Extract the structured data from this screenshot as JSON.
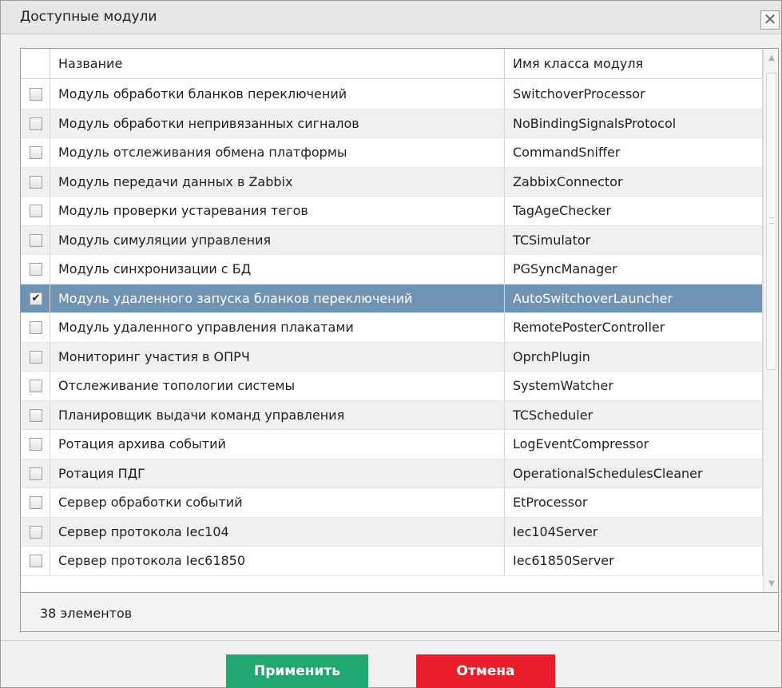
{
  "window": {
    "title": "Доступные модули",
    "close_glyph": "✕"
  },
  "table": {
    "columns": [
      "",
      "Название",
      "Имя класса модуля"
    ],
    "rows": [
      {
        "checked": false,
        "name": "Модуль обработки бланков переключений",
        "class_name": "SwitchoverProcessor"
      },
      {
        "checked": false,
        "name": "Модуль обработки непривязанных сигналов",
        "class_name": "NoBindingSignalsProtocol"
      },
      {
        "checked": false,
        "name": "Модуль отслеживания обмена платформы",
        "class_name": "CommandSniffer"
      },
      {
        "checked": false,
        "name": "Модуль передачи данных в Zabbix",
        "class_name": "ZabbixConnector"
      },
      {
        "checked": false,
        "name": "Модуль проверки устаревания тегов",
        "class_name": "TagAgeChecker"
      },
      {
        "checked": false,
        "name": "Модуль симуляции управления",
        "class_name": "TCSimulator"
      },
      {
        "checked": false,
        "name": "Модуль синхронизации с БД",
        "class_name": "PGSyncManager"
      },
      {
        "checked": true,
        "name": "Модуль удаленного запуска бланков переключений",
        "class_name": "AutoSwitchoverLauncher"
      },
      {
        "checked": false,
        "name": "Модуль удаленного управления плакатами",
        "class_name": "RemotePosterController"
      },
      {
        "checked": false,
        "name": "Мониторинг участия в ОПРЧ",
        "class_name": "OprchPlugin"
      },
      {
        "checked": false,
        "name": "Отслеживание топологии системы",
        "class_name": "SystemWatcher"
      },
      {
        "checked": false,
        "name": "Планировщик выдачи команд управления",
        "class_name": "TCScheduler"
      },
      {
        "checked": false,
        "name": "Ротация архива событий",
        "class_name": "LogEventCompressor"
      },
      {
        "checked": false,
        "name": "Ротация ПДГ",
        "class_name": "OperationalSchedulesCleaner"
      },
      {
        "checked": false,
        "name": "Сервер обработки событий",
        "class_name": "EtProcessor"
      },
      {
        "checked": false,
        "name": "Сервер протокола Iec104",
        "class_name": "Iec104Server"
      },
      {
        "checked": false,
        "name": "Сервер протокола Iec61850",
        "class_name": "Iec61850Server"
      }
    ],
    "selected_index": 7
  },
  "status": {
    "count_text": "38 элементов"
  },
  "buttons": {
    "apply_label": "Применить",
    "cancel_label": "Отмена"
  },
  "colors": {
    "apply": "#21a770",
    "cancel": "#ec1d2a",
    "selected_row": "#6f93b3"
  }
}
